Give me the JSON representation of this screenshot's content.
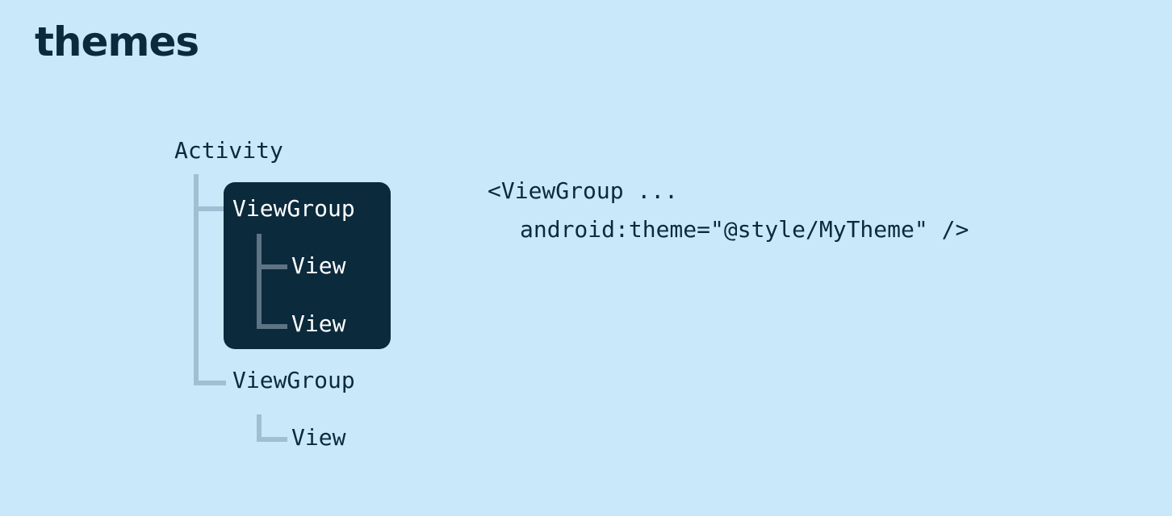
{
  "title": "themes",
  "tree": {
    "root": "Activity",
    "highlighted_group": {
      "label": "ViewGroup",
      "children": [
        "View",
        "View"
      ]
    },
    "second_group": {
      "label": "ViewGroup",
      "children": [
        "View"
      ]
    }
  },
  "code": {
    "line1": "<ViewGroup ...",
    "line2": "android:theme=\"@style/MyTheme\" />"
  },
  "colors": {
    "background": "#c9e9fa",
    "text": "#0c2a3e",
    "highlight_box": "#0b2a3c",
    "connector": "#9fbfd3"
  }
}
